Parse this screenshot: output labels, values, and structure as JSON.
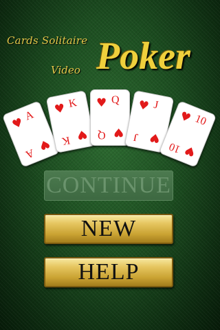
{
  "subtitle": "Cards Solitaire",
  "title_small": "Video",
  "title_large": "Poker",
  "cards": [
    {
      "rank": "A",
      "suit": "♥"
    },
    {
      "rank": "K",
      "suit": "♥"
    },
    {
      "rank": "Q",
      "suit": "♥"
    },
    {
      "rank": "J",
      "suit": "♥"
    },
    {
      "rank": "10",
      "suit": "♥"
    }
  ],
  "buttons": {
    "continue_label": "CONTINUE",
    "new_label": "NEW",
    "help_label": "HELP"
  },
  "colors": {
    "felt": "#1c4d20",
    "gold": "#e3c74a",
    "hearts": "#e21a1a"
  }
}
